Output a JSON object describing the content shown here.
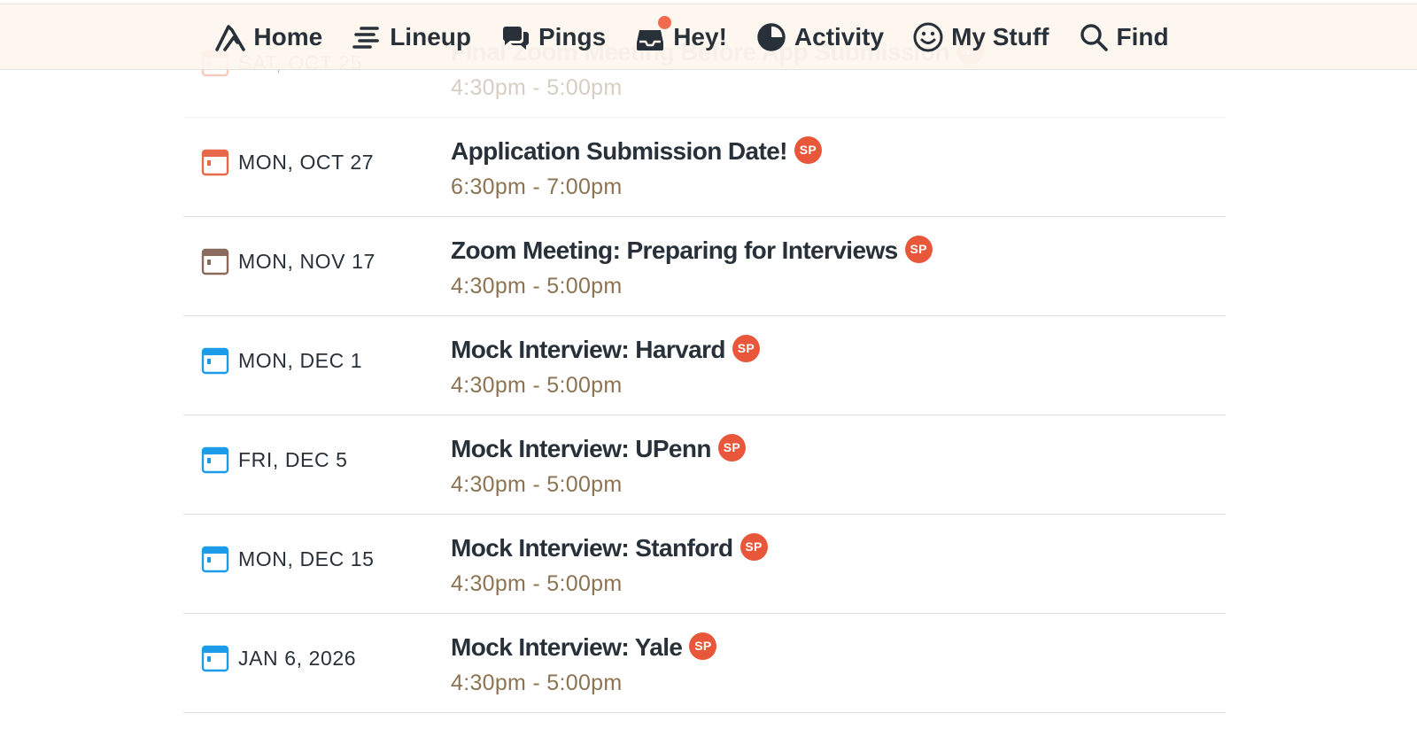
{
  "nav": {
    "items": [
      {
        "label": "Home",
        "icon": "home-icon"
      },
      {
        "label": "Lineup",
        "icon": "lineup-icon"
      },
      {
        "label": "Pings",
        "icon": "pings-icon"
      },
      {
        "label": "Hey!",
        "icon": "hey-icon",
        "notification": true
      },
      {
        "label": "Activity",
        "icon": "activity-icon"
      },
      {
        "label": "My Stuff",
        "icon": "smiley-icon"
      },
      {
        "label": "Find",
        "icon": "search-icon"
      }
    ]
  },
  "colors": {
    "accent": "#e8573a",
    "time_text": "#8c7453",
    "calendar_orange": "#e8694a",
    "calendar_brown": "#8a6a5c",
    "calendar_blue": "#1b9be8",
    "nav_bg": "#fdf6ee"
  },
  "events": [
    {
      "date": "SAT, OCT 25",
      "title": "Final Zoom Meeting Before App Submission",
      "time": "4:30pm - 5:00pm",
      "avatar": "SP",
      "calendar_color": "orange",
      "faded": true
    },
    {
      "date": "MON, OCT 27",
      "title": "Application Submission Date!",
      "time": "6:30pm - 7:00pm",
      "avatar": "SP",
      "calendar_color": "orange"
    },
    {
      "date": "MON, NOV 17",
      "title": "Zoom Meeting: Preparing for Interviews",
      "time": "4:30pm - 5:00pm",
      "avatar": "SP",
      "calendar_color": "brown"
    },
    {
      "date": "MON, DEC 1",
      "title": "Mock Interview: Harvard",
      "time": "4:30pm - 5:00pm",
      "avatar": "SP",
      "calendar_color": "blue"
    },
    {
      "date": "FRI, DEC 5",
      "title": "Mock Interview: UPenn",
      "time": "4:30pm - 5:00pm",
      "avatar": "SP",
      "calendar_color": "blue"
    },
    {
      "date": "MON, DEC 15",
      "title": "Mock Interview: Stanford",
      "time": "4:30pm - 5:00pm",
      "avatar": "SP",
      "calendar_color": "blue"
    },
    {
      "date": "JAN 6, 2026",
      "title": "Mock Interview: Yale",
      "time": "4:30pm - 5:00pm",
      "avatar": "SP",
      "calendar_color": "blue"
    }
  ]
}
